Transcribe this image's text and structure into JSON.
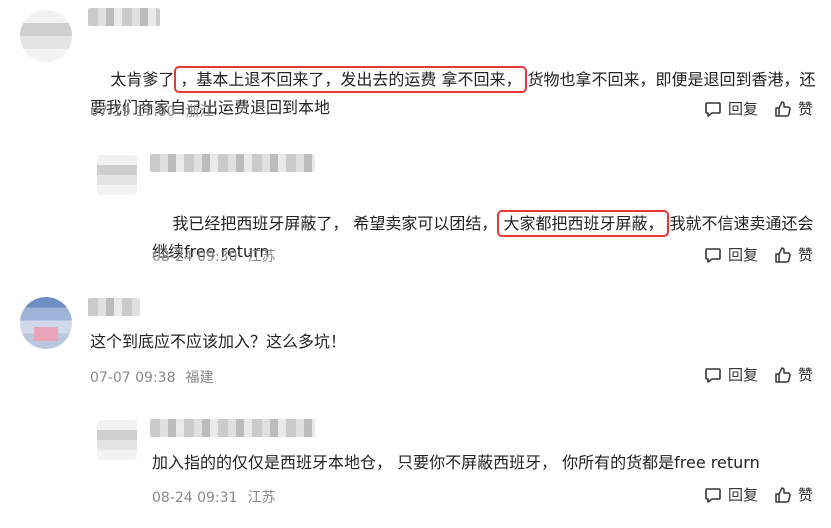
{
  "comments": [
    {
      "text_before": "太肯爹了",
      "text_highlight": "，基本上退不回来了，发出去的运费 拿不回来，",
      "text_after": "货物也拿不回来，即便是退回到香港，还要我们商家自己出运费退回到本地",
      "time": "07-19 17:00",
      "location": "浙江",
      "reply": "回复",
      "like": "赞"
    },
    {
      "text_before": "我已经把西班牙屏蔽了， 希望卖家可以团结，",
      "text_highlight": "大家都把西班牙屏蔽，",
      "text_after": "我就不信速卖通还会继续free return",
      "time": "08-24 09:30",
      "location": "江苏",
      "reply": "回复",
      "like": "赞"
    },
    {
      "text": "这个到底应不应该加入？这么多坑！",
      "time": "07-07 09:38",
      "location": "福建",
      "reply": "回复",
      "like": "赞"
    },
    {
      "text": "加入指的的仅仅是西班牙本地仓， 只要你不屏蔽西班牙， 你所有的货都是free return",
      "time": "08-24 09:31",
      "location": "江苏",
      "reply": "回复",
      "like": "赞"
    }
  ]
}
